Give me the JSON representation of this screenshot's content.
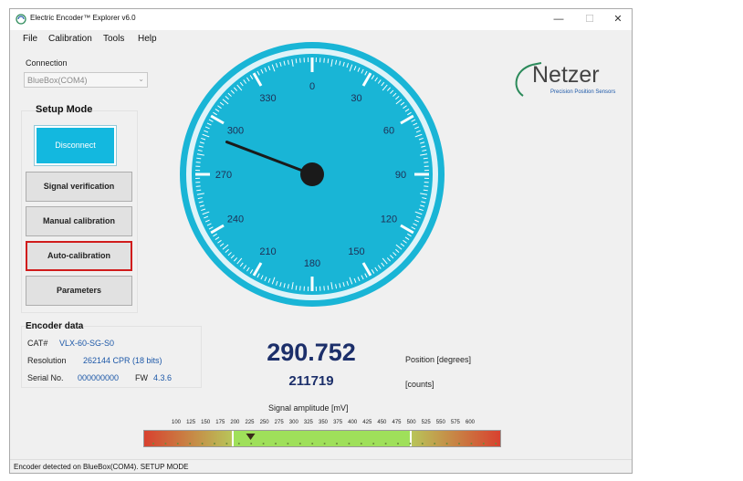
{
  "window": {
    "title": "Electric Encoder™ Explorer v6.0",
    "controls": {
      "minimize": "—",
      "maximize": "☐",
      "close": "✕"
    }
  },
  "menu": {
    "items": [
      "File",
      "Calibration",
      "Tools",
      "Help"
    ]
  },
  "connection": {
    "label": "Connection",
    "value": "BlueBox(COM4)"
  },
  "setup": {
    "title": "Setup Mode",
    "buttons": {
      "disconnect": "Disconnect",
      "signal_verification": "Signal verification",
      "manual_calibration": "Manual calibration",
      "auto_calibration": "Auto-calibration",
      "parameters": "Parameters"
    }
  },
  "encoder": {
    "title": "Encoder data",
    "cat_label": "CAT#",
    "cat_value": "VLX-60-SG-S0",
    "resolution_label": "Resolution",
    "resolution_value": "262144 CPR (18 bits)",
    "serial_label": "Serial No.",
    "serial_value": "000000000",
    "fw_label": "FW",
    "fw_value": "4.3.6"
  },
  "logo": {
    "name": "Netzer",
    "tagline": "Precision Position Sensors"
  },
  "gauge": {
    "labels": [
      "0",
      "30",
      "60",
      "90",
      "120",
      "150",
      "180",
      "210",
      "240",
      "270",
      "300",
      "330"
    ],
    "angle_degrees": 290.752,
    "colors": {
      "face": "#19b5d6",
      "rim": "#dff3f8",
      "needle": "#1a1a1a"
    }
  },
  "readout": {
    "position_value": "290.752",
    "position_label": "Position [degrees]",
    "counts_value": "211719",
    "counts_label": "[counts]"
  },
  "signal": {
    "title": "Signal amplitude [mV]",
    "scale": [
      "100",
      "125",
      "150",
      "175",
      "200",
      "225",
      "250",
      "275",
      "300",
      "325",
      "350",
      "375",
      "400",
      "425",
      "450",
      "475",
      "500",
      "525",
      "550",
      "575",
      "600"
    ],
    "current_mv": 225
  },
  "status": {
    "text": "Encoder detected on BlueBox(COM4). SETUP MODE"
  }
}
